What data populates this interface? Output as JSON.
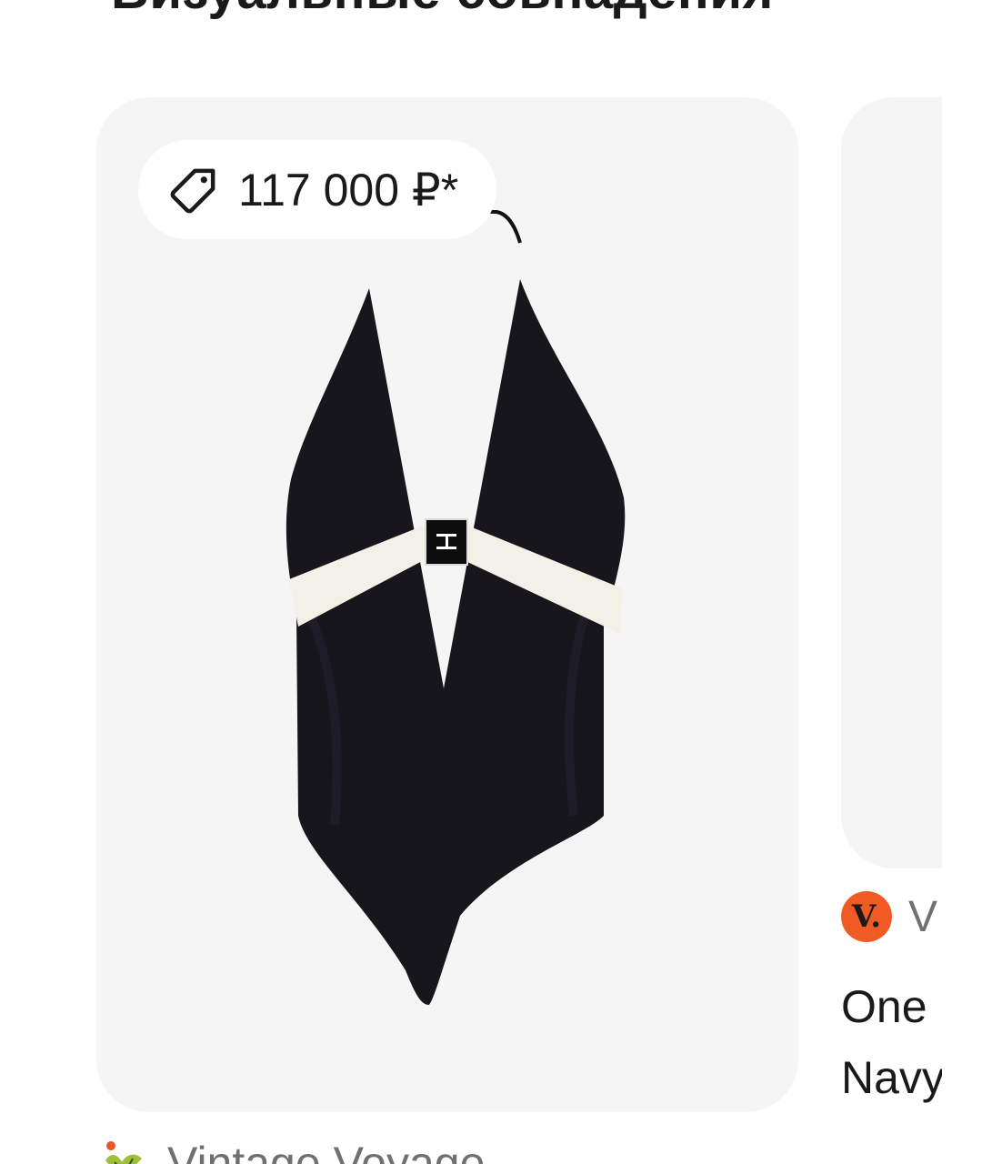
{
  "section": {
    "title": "Визуальные совпадения"
  },
  "cards": [
    {
      "price": "117 000 ₽*",
      "price_icon": "price-tag-icon",
      "image": "black-halter-swimsuit",
      "seller": {
        "name": "Vintage Voyage",
        "logo_icon": "vintage-voyage-logo"
      }
    },
    {
      "seller": {
        "name": "V",
        "logo_text": "V.",
        "logo_color": "#f05a23"
      },
      "title": "One\nNavy"
    }
  ],
  "colors": {
    "card_background": "#f5f5f5",
    "text_primary": "#1a1a1a",
    "text_secondary": "#707070",
    "accent_orange": "#f05a23"
  }
}
